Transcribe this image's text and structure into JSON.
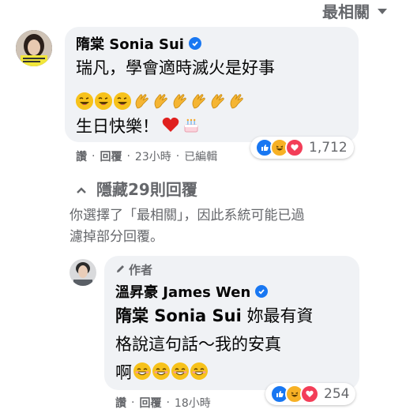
{
  "sort": {
    "label": "最相關"
  },
  "comment1": {
    "author": "隋棠 Sonia Sui",
    "line1": "瑞凡，學會適時滅火是好事",
    "line3": "生日快樂！",
    "actions": {
      "like": "讚",
      "dot1": "·",
      "reply": "回覆",
      "dot2": "·",
      "time": "23小時",
      "dot3": "·",
      "edited": "已編輯"
    },
    "reactions": {
      "count": "1,712",
      "icons": [
        "like-icon",
        "haha-icon",
        "love-icon"
      ]
    },
    "emoji_row": [
      "laughing-wink",
      "laughing-wink",
      "laughing-wink",
      "clap",
      "clap",
      "clap",
      "clap",
      "clap",
      "clap"
    ]
  },
  "hidden_replies": {
    "label": "隱藏29則回覆"
  },
  "notice": {
    "line1": "你選擇了「最相關」，因此系統可能已過",
    "line2": "濾掉部分回覆。"
  },
  "reply1": {
    "badge": "作者",
    "author": "溫昇豪 James Wen",
    "mention": "隋棠 Sonia Sui",
    "text1": " 妳最有資",
    "text2": "格說這句話～我的安真",
    "text3": "啊",
    "actions": {
      "like": "讚",
      "dot1": "·",
      "reply": "回覆",
      "dot2": "·",
      "time": "18小時"
    },
    "reactions": {
      "count": "254",
      "icons": [
        "like-icon",
        "haha-icon",
        "love-icon"
      ]
    }
  },
  "colors": {
    "accent": "#1877f2",
    "bubble": "#f0f2f5",
    "muted": "#65676b",
    "love": "#f33e58",
    "haha": "#f7b125"
  }
}
